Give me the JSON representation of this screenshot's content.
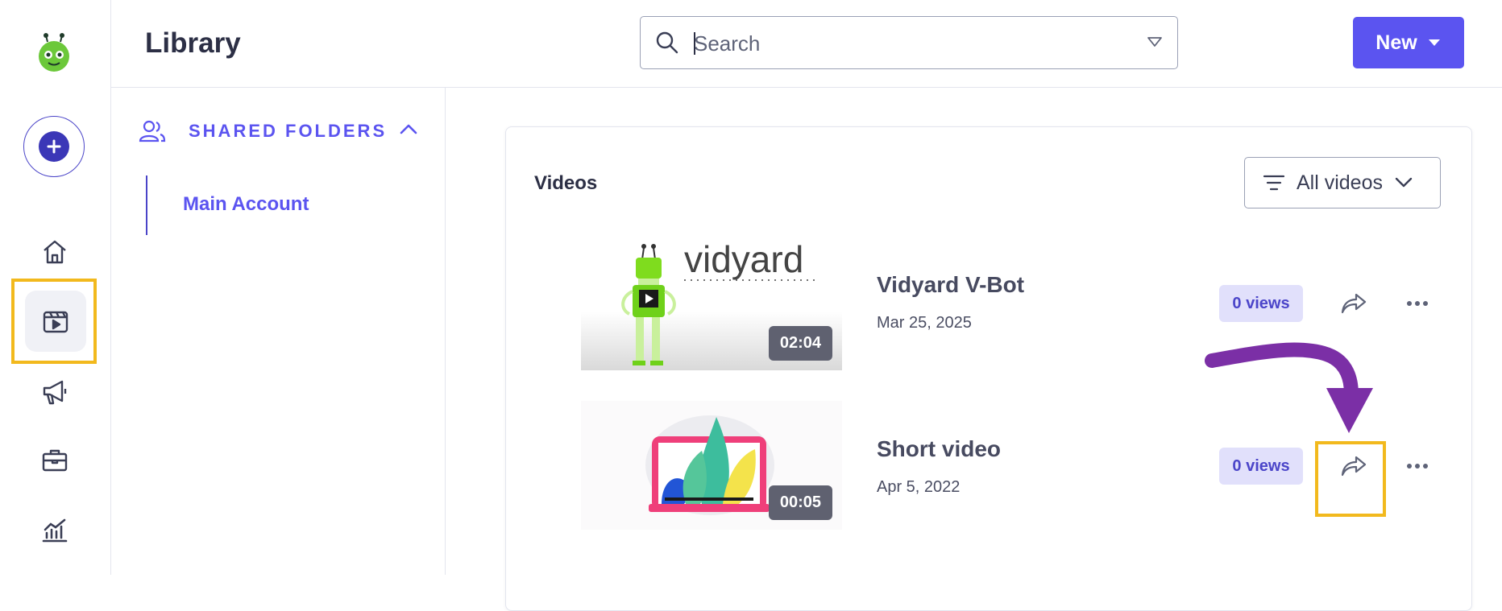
{
  "header": {
    "title": "Library",
    "search": {
      "placeholder": "Search",
      "value": ""
    },
    "new_button": "New"
  },
  "sidebar": {
    "items": [
      {
        "name": "home",
        "icon": "home-icon"
      },
      {
        "name": "videos",
        "icon": "video-library-icon",
        "active": true
      },
      {
        "name": "campaigns",
        "icon": "megaphone-icon"
      },
      {
        "name": "hubs",
        "icon": "briefcase-icon"
      },
      {
        "name": "analytics",
        "icon": "chart-icon"
      }
    ]
  },
  "folders": {
    "section_label": "SHARED FOLDERS",
    "items": [
      {
        "label": "Main Account"
      }
    ]
  },
  "videos": {
    "title": "Videos",
    "filter_label": "All videos",
    "items": [
      {
        "title": "Vidyard V-Bot",
        "date": "Mar 25, 2025",
        "duration": "02:04",
        "views": "0 views",
        "thumb_wordmark": "vidyard"
      },
      {
        "title": "Short video",
        "date": "Apr 5, 2022",
        "duration": "00:05",
        "views": "0 views"
      }
    ]
  },
  "colors": {
    "accent": "#5b54f0",
    "accent_dark": "#3b37b7",
    "highlight": "#f2b91d",
    "annotation_arrow": "#7b2fa6",
    "views_badge_bg": "#e1e0fb"
  }
}
